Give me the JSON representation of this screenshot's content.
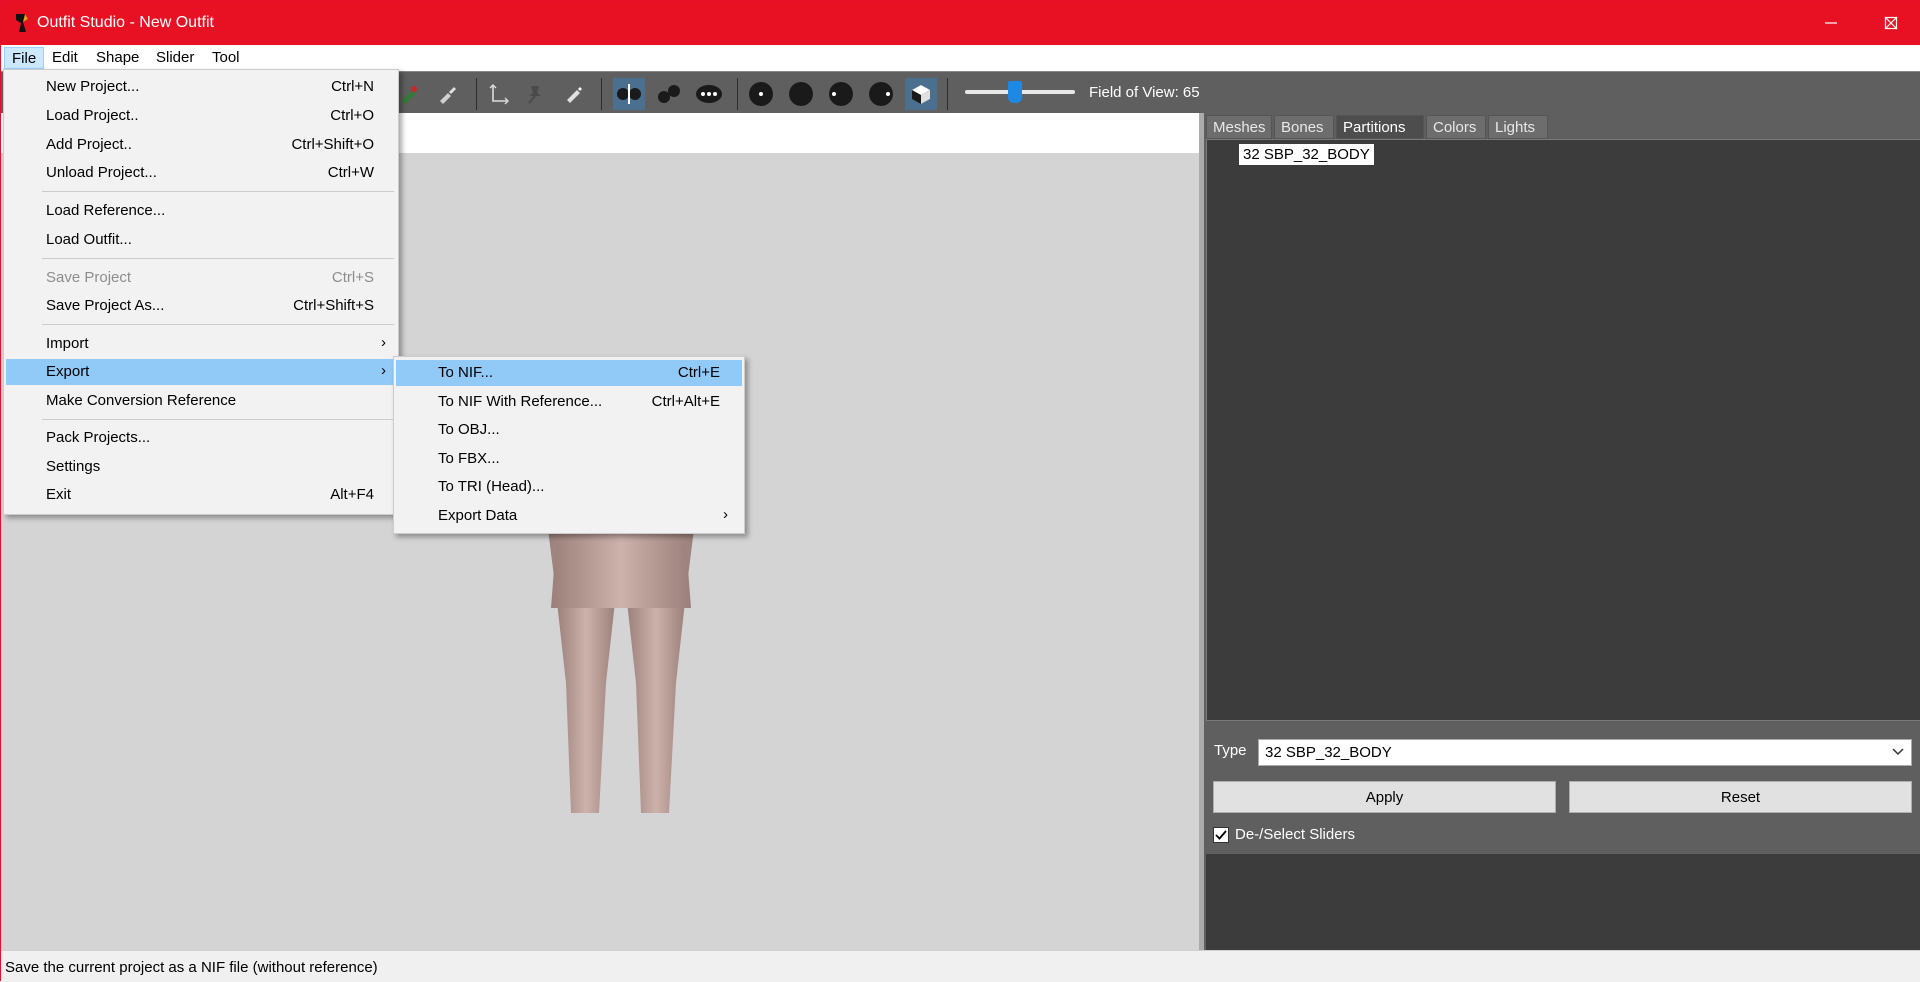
{
  "window": {
    "title": "Outfit Studio - New Outfit"
  },
  "menubar": {
    "items": [
      "File",
      "Edit",
      "Shape",
      "Slider",
      "Tool"
    ]
  },
  "toolbar": {
    "fov_label": "Field of View: 65",
    "fov_value": 65
  },
  "file_menu": {
    "items": [
      {
        "label": "New Project...",
        "shortcut": "Ctrl+N"
      },
      {
        "label": "Load Project..",
        "shortcut": "Ctrl+O"
      },
      {
        "label": "Add Project..",
        "shortcut": "Ctrl+Shift+O"
      },
      {
        "label": "Unload Project...",
        "shortcut": "Ctrl+W"
      },
      {
        "label": "Load Reference...",
        "shortcut": ""
      },
      {
        "label": "Load Outfit...",
        "shortcut": ""
      },
      {
        "label": "Save Project",
        "shortcut": "Ctrl+S"
      },
      {
        "label": "Save Project As...",
        "shortcut": "Ctrl+Shift+S"
      },
      {
        "label": "Import",
        "shortcut": ""
      },
      {
        "label": "Export",
        "shortcut": ""
      },
      {
        "label": "Make Conversion Reference",
        "shortcut": ""
      },
      {
        "label": "Pack Projects...",
        "shortcut": ""
      },
      {
        "label": "Settings",
        "shortcut": ""
      },
      {
        "label": "Exit",
        "shortcut": "Alt+F4"
      }
    ]
  },
  "export_menu": {
    "items": [
      {
        "label": "To NIF...",
        "shortcut": "Ctrl+E"
      },
      {
        "label": "To NIF With Reference...",
        "shortcut": "Ctrl+Alt+E"
      },
      {
        "label": "To OBJ...",
        "shortcut": ""
      },
      {
        "label": "To FBX...",
        "shortcut": ""
      },
      {
        "label": "To TRI (Head)...",
        "shortcut": ""
      },
      {
        "label": "Export Data",
        "shortcut": ""
      }
    ]
  },
  "right_panel": {
    "tabs": [
      "Meshes",
      "Bones",
      "Partitions",
      "Colors",
      "Lights"
    ],
    "active_tab": "Partitions",
    "tree_items": [
      "32 SBP_32_BODY"
    ],
    "type_label": "Type",
    "type_value": "32 SBP_32_BODY",
    "apply_label": "Apply",
    "reset_label": "Reset",
    "checkbox_label": "De-/Select Sliders",
    "checkbox_checked": true
  },
  "statusbar": {
    "text": "Save the current project as a NIF file (without reference)"
  },
  "colors": {
    "titlebar": "#e81123",
    "highlight": "#91c9f7",
    "panel": "#5f5f5f"
  }
}
